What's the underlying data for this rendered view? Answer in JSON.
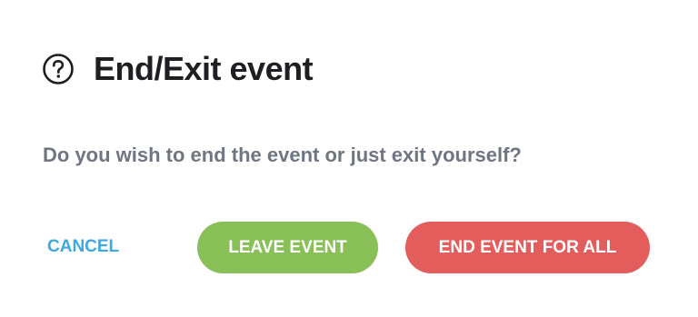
{
  "dialog": {
    "title": "End/Exit event",
    "help_icon": "question-circle-icon",
    "message": "Do you wish to end the event or just exit yourself?"
  },
  "actions": {
    "cancel_label": "CANCEL",
    "leave_label": "LEAVE EVENT",
    "end_all_label": "END EVENT FOR ALL"
  },
  "colors": {
    "cancel": "#3fa8e0",
    "leave": "#88c057",
    "end_all": "#e35d5d",
    "title": "#1f1f23",
    "message": "#6e7682"
  }
}
